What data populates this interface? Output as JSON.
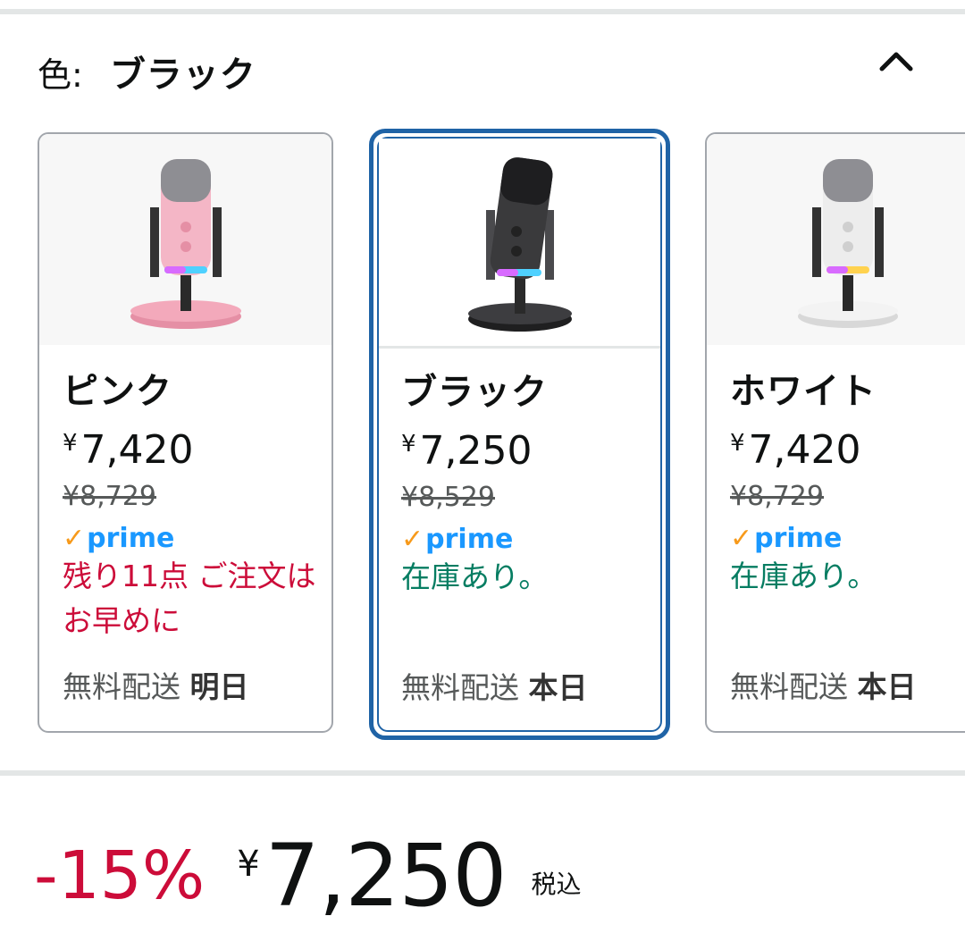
{
  "color_selector": {
    "label": "色:",
    "selected_value": "ブラック",
    "collapse_icon": "chevron-up-icon"
  },
  "variants": [
    {
      "name": "ピンク",
      "currency": "¥",
      "price": "7,420",
      "list_price": "¥8,729",
      "prime_label": "prime",
      "stock": "残り11点 ご注文はお早めに",
      "stock_status": "low",
      "delivery_label": "無料配送",
      "delivery_day": "明日",
      "color_hex": "#f4b6c6"
    },
    {
      "name": "ブラック",
      "currency": "¥",
      "price": "7,250",
      "list_price": "¥8,529",
      "prime_label": "prime",
      "stock": "在庫あり。",
      "stock_status": "in_stock",
      "delivery_label": "無料配送",
      "delivery_day": "本日",
      "color_hex": "#3a3a3c",
      "selected": true
    },
    {
      "name": "ホワイト",
      "currency": "¥",
      "price": "7,420",
      "list_price": "¥8,729",
      "prime_label": "prime",
      "stock": "在庫あり。",
      "stock_status": "in_stock",
      "delivery_label": "無料配送",
      "delivery_day": "本日",
      "color_hex": "#eeeeee"
    }
  ],
  "price_summary": {
    "discount": "-15%",
    "currency": "¥",
    "price": "7,250",
    "tax_note": "税込"
  },
  "colors": {
    "selected_border": "#1f63a6",
    "discount_red": "#cc0c39",
    "in_stock_green": "#067d62",
    "prime_blue": "#1a98ff",
    "prime_check_orange": "#f79a1b"
  }
}
